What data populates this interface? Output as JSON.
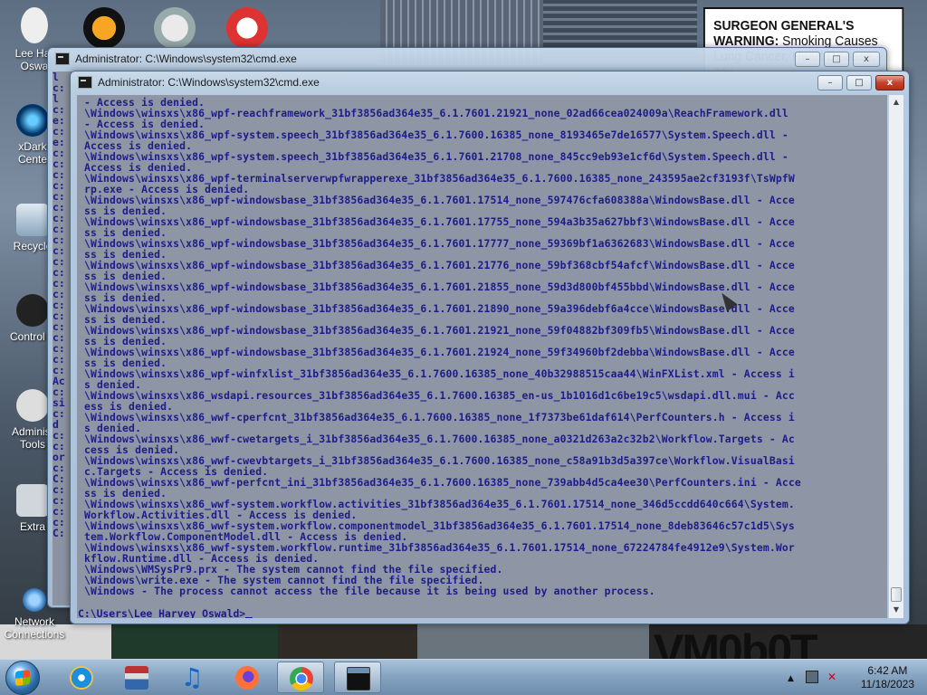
{
  "desktop": {
    "icons": [
      {
        "label": "Lee Harvey Oswald",
        "visible_label": "Lee Har\nOswa"
      },
      {
        "label": "xDark Cente",
        "visible_label": "xDark\nCente"
      },
      {
        "label": "Recycle",
        "visible_label": "Recycle"
      },
      {
        "label": "Control P",
        "visible_label": "Control P"
      },
      {
        "label": "Administ Tools",
        "visible_label": "Administ\nTools"
      },
      {
        "label": "Extra",
        "visible_label": "Extra"
      },
      {
        "label": "Network Connections",
        "visible_label": "Network\nConnections"
      }
    ],
    "warning_bold": "SURGEON GENERAL'S WARNING:",
    "warning_rest": "Smoking Causes Lung Cancer, Heart Disease, ncy.",
    "bottom_text": "VM0b0T"
  },
  "back_window": {
    "title": "Administrator: C:\\Windows\\system32\\cmd.exe",
    "left_column": [
      "l",
      "c:",
      "l",
      "c:",
      "e:",
      "c:",
      "e:",
      "c:",
      "c:",
      "c:",
      "c:",
      "c:",
      "c:",
      "c:",
      "c:",
      "c:",
      "c:",
      "c:",
      "c:",
      "c:",
      "c:",
      "c:",
      "c:",
      "c:",
      "c:",
      "c:",
      "c:",
      "c:",
      "Ac",
      "c:",
      "si",
      "c:",
      "d",
      "c:",
      "c:",
      "or",
      "c:",
      "C:",
      "c:",
      "c:",
      "c:",
      "c:",
      "C:"
    ]
  },
  "front_window": {
    "title": "Administrator: C:\\Windows\\system32\\cmd.exe",
    "minimize": "–",
    "maximize": "□",
    "close": "x",
    "lines": [
      " - Access is denied.",
      " \\Windows\\winsxs\\x86_wpf-reachframework_31bf3856ad364e35_6.1.7601.21921_none_02ad66cea024009a\\ReachFramework.dll",
      " - Access is denied.",
      " \\Windows\\winsxs\\x86_wpf-system.speech_31bf3856ad364e35_6.1.7600.16385_none_8193465e7de16577\\System.Speech.dll -",
      " Access is denied.",
      " \\Windows\\winsxs\\x86_wpf-system.speech_31bf3856ad364e35_6.1.7601.21708_none_845cc9eb93e1cf6d\\System.Speech.dll -",
      " Access is denied.",
      " \\Windows\\winsxs\\x86_wpf-terminalserverwpfwrapperexe_31bf3856ad364e35_6.1.7600.16385_none_243595ae2cf3193f\\TsWpfW",
      " rp.exe - Access is denied.",
      " \\Windows\\winsxs\\x86_wpf-windowsbase_31bf3856ad364e35_6.1.7601.17514_none_597476cfa608388a\\WindowsBase.dll - Acce",
      " ss is denied.",
      " \\Windows\\winsxs\\x86_wpf-windowsbase_31bf3856ad364e35_6.1.7601.17755_none_594a3b35a627bbf3\\WindowsBase.dll - Acce",
      " ss is denied.",
      " \\Windows\\winsxs\\x86_wpf-windowsbase_31bf3856ad364e35_6.1.7601.17777_none_59369bf1a6362683\\WindowsBase.dll - Acce",
      " ss is denied.",
      " \\Windows\\winsxs\\x86_wpf-windowsbase_31bf3856ad364e35_6.1.7601.21776_none_59bf368cbf54afcf\\WindowsBase.dll - Acce",
      " ss is denied.",
      " \\Windows\\winsxs\\x86_wpf-windowsbase_31bf3856ad364e35_6.1.7601.21855_none_59d3d800bf455bbd\\WindowsBase.dll - Acce",
      " ss is denied.",
      " \\Windows\\winsxs\\x86_wpf-windowsbase_31bf3856ad364e35_6.1.7601.21890_none_59a396debf6a4cce\\WindowsBase.dll - Acce",
      " ss is denied.",
      " \\Windows\\winsxs\\x86_wpf-windowsbase_31bf3856ad364e35_6.1.7601.21921_none_59f04882bf309fb5\\WindowsBase.dll - Acce",
      " ss is denied.",
      " \\Windows\\winsxs\\x86_wpf-windowsbase_31bf3856ad364e35_6.1.7601.21924_none_59f34960bf2debba\\WindowsBase.dll - Acce",
      " ss is denied.",
      " \\Windows\\winsxs\\x86_wpf-winfxlist_31bf3856ad364e35_6.1.7600.16385_none_40b32988515caa44\\WinFXList.xml - Access i",
      " s denied.",
      " \\Windows\\winsxs\\x86_wsdapi.resources_31bf3856ad364e35_6.1.7600.16385_en-us_1b1016d1c6be19c5\\wsdapi.dll.mui - Acc",
      " ess is denied.",
      " \\Windows\\winsxs\\x86_wwf-cperfcnt_31bf3856ad364e35_6.1.7600.16385_none_1f7373be61daf614\\PerfCounters.h - Access i",
      " s denied.",
      " \\Windows\\winsxs\\x86_wwf-cwetargets_i_31bf3856ad364e35_6.1.7600.16385_none_a0321d263a2c32b2\\Workflow.Targets - Ac",
      " cess is denied.",
      " \\Windows\\winsxs\\x86_wwf-cwevbtargets_i_31bf3856ad364e35_6.1.7600.16385_none_c58a91b3d5a397ce\\Workflow.VisualBasi",
      " c.Targets - Access is denied.",
      " \\Windows\\winsxs\\x86_wwf-perfcnt_ini_31bf3856ad364e35_6.1.7600.16385_none_739abb4d5ca4ee30\\PerfCounters.ini - Acce",
      " ss is denied.",
      " \\Windows\\winsxs\\x86_wwf-system.workflow.activities_31bf3856ad364e35_6.1.7601.17514_none_346d5ccdd640c664\\System.",
      " Workflow.Activities.dll - Access is denied.",
      " \\Windows\\winsxs\\x86_wwf-system.workflow.componentmodel_31bf3856ad364e35_6.1.7601.17514_none_8deb83646c57c1d5\\Sys",
      " tem.Workflow.ComponentModel.dll - Access is denied.",
      " \\Windows\\winsxs\\x86_wwf-system.workflow.runtime_31bf3856ad364e35_6.1.7601.17514_none_67224784fe4912e9\\System.Wor",
      " kflow.Runtime.dll - Access is denied.",
      " \\Windows\\WMSysPr9.prx - The system cannot find the file specified.",
      " \\Windows\\write.exe - The system cannot find the file specified.",
      " \\Windows - The process cannot access the file because it is being used by another process."
    ],
    "prompt": "C:\\Users\\Lee Harvey Oswald>"
  },
  "taskbar": {
    "time": "6:42 AM",
    "date": "11/18/2023",
    "apps": [
      "internet-explorer",
      "winrar",
      "music",
      "firefox",
      "chrome",
      "cmd"
    ]
  }
}
